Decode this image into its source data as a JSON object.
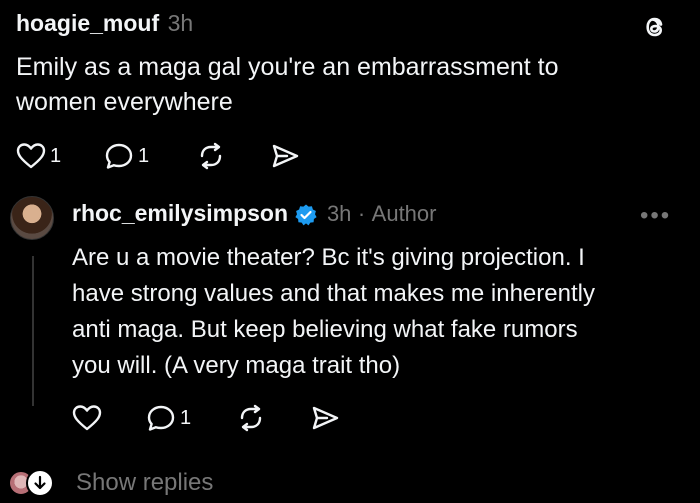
{
  "post": {
    "username": "hoagie_mouf",
    "time": "3h",
    "text_line1": "Emily as a maga gal you're an embarrassment to",
    "text_line2": "women everywhere",
    "like_count": "1",
    "reply_count": "1",
    "icon": "threads-logo-icon"
  },
  "reply": {
    "username": "rhoc_emilysimpson",
    "time": "3h",
    "separator": "·",
    "role": "Author",
    "more": "•••",
    "lines": [
      "Are u a movie theater? Bc it's giving projection. I",
      "have strong values and that makes me inherently",
      "anti maga. But keep believing what fake rumors",
      "you will. (A very maga trait tho)"
    ],
    "reply_count": "1"
  },
  "footer": {
    "show_replies": "Show replies"
  },
  "colors": {
    "background": "#000000",
    "text": "#f3f5f7",
    "muted": "#777777",
    "verified": "#1d9bf0"
  }
}
